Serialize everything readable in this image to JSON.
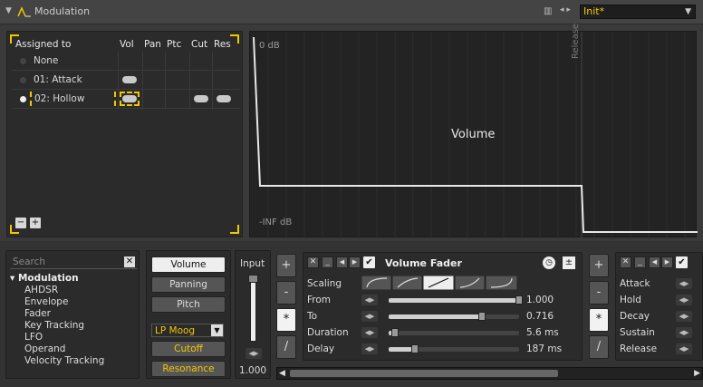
{
  "title": "Modulation",
  "preset": "Init*",
  "assign": {
    "headers": [
      "Assigned to",
      "Vol",
      "Pan",
      "Ptc",
      "Cut",
      "Res"
    ],
    "rows": [
      {
        "label": "None"
      },
      {
        "label": "01: Attack"
      },
      {
        "label": "02: Hollow"
      }
    ],
    "minus": "−",
    "plus": "+"
  },
  "graph": {
    "top_label": "0 dB",
    "bottom_label": "-INF dB",
    "center_label": "Volume",
    "release_label": "Release"
  },
  "browser": {
    "search_placeholder": "Search",
    "root": "Modulation",
    "items": [
      "AHDSR",
      "Envelope",
      "Fader",
      "Key Tracking",
      "LFO",
      "Operand",
      "Velocity Tracking"
    ]
  },
  "targets": {
    "buttons": [
      "Volume",
      "Panning",
      "Pitch"
    ],
    "filter_type": "LP Moog",
    "filter_buttons": [
      "Cutoff",
      "Resonance"
    ]
  },
  "input": {
    "label": "Input",
    "value": "1.000"
  },
  "ops": [
    "+",
    "-",
    "*",
    "/"
  ],
  "fader_device": {
    "name": "Volume Fader",
    "params": [
      {
        "label": "Scaling",
        "value": ""
      },
      {
        "label": "From",
        "value": "1.000"
      },
      {
        "label": "To",
        "value": "0.716"
      },
      {
        "label": "Duration",
        "value": "5.6 ms"
      },
      {
        "label": "Delay",
        "value": "187 ms"
      }
    ],
    "levels": {
      "from": 1.0,
      "to": 0.716,
      "duration": 0.05,
      "delay": 0.2
    }
  },
  "adsr_device": {
    "params": [
      "Attack",
      "Hold",
      "Decay",
      "Sustain",
      "Release"
    ]
  },
  "colors": {
    "accent": "#f0c800",
    "bg": "#3a3a3a",
    "panel": "#2b2b2b"
  }
}
